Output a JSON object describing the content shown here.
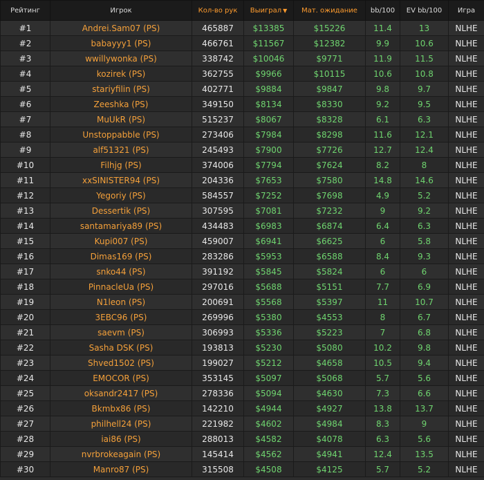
{
  "headers": {
    "rank": "Рейтинг",
    "player": "Игрок",
    "hands": "Кол-во рук",
    "won": "Выиграл",
    "ev": "Мат. ожидание",
    "bb100": "bb/100",
    "evbb100": "EV bb/100",
    "game": "Игра"
  },
  "sort": {
    "column": "won",
    "direction": "desc",
    "indicator": "▼"
  },
  "colors": {
    "accent": "#ff9c2e",
    "positive": "#6fd46f",
    "player": "#f4a03a",
    "text": "#e8e8e8",
    "background": "#2d2d2d"
  },
  "rows": [
    {
      "rank": "#1",
      "player": "Andrei.Sam07 (PS)",
      "hands": "465887",
      "won": "$13385",
      "ev": "$15226",
      "bb100": "11.4",
      "evbb100": "13",
      "game": "NLHE"
    },
    {
      "rank": "#2",
      "player": "babayyy1 (PS)",
      "hands": "466761",
      "won": "$11567",
      "ev": "$12382",
      "bb100": "9.9",
      "evbb100": "10.6",
      "game": "NLHE"
    },
    {
      "rank": "#3",
      "player": "wwillywonka (PS)",
      "hands": "338742",
      "won": "$10046",
      "ev": "$9771",
      "bb100": "11.9",
      "evbb100": "11.5",
      "game": "NLHE"
    },
    {
      "rank": "#4",
      "player": "kozirek (PS)",
      "hands": "362755",
      "won": "$9966",
      "ev": "$10115",
      "bb100": "10.6",
      "evbb100": "10.8",
      "game": "NLHE"
    },
    {
      "rank": "#5",
      "player": "stariyfilin (PS)",
      "hands": "402771",
      "won": "$9884",
      "ev": "$9847",
      "bb100": "9.8",
      "evbb100": "9.7",
      "game": "NLHE"
    },
    {
      "rank": "#6",
      "player": "Zeeshka (PS)",
      "hands": "349150",
      "won": "$8134",
      "ev": "$8330",
      "bb100": "9.2",
      "evbb100": "9.5",
      "game": "NLHE"
    },
    {
      "rank": "#7",
      "player": "MuUkR (PS)",
      "hands": "515237",
      "won": "$8067",
      "ev": "$8328",
      "bb100": "6.1",
      "evbb100": "6.3",
      "game": "NLHE"
    },
    {
      "rank": "#8",
      "player": "Unstoppabble (PS)",
      "hands": "273406",
      "won": "$7984",
      "ev": "$8298",
      "bb100": "11.6",
      "evbb100": "12.1",
      "game": "NLHE"
    },
    {
      "rank": "#9",
      "player": "alf51321 (PS)",
      "hands": "245493",
      "won": "$7900",
      "ev": "$7726",
      "bb100": "12.7",
      "evbb100": "12.4",
      "game": "NLHE"
    },
    {
      "rank": "#10",
      "player": "Filhjg (PS)",
      "hands": "374006",
      "won": "$7794",
      "ev": "$7624",
      "bb100": "8.2",
      "evbb100": "8",
      "game": "NLHE"
    },
    {
      "rank": "#11",
      "player": "xxSINISTER94 (PS)",
      "hands": "204336",
      "won": "$7653",
      "ev": "$7580",
      "bb100": "14.8",
      "evbb100": "14.6",
      "game": "NLHE"
    },
    {
      "rank": "#12",
      "player": "Yegoriy (PS)",
      "hands": "584557",
      "won": "$7252",
      "ev": "$7698",
      "bb100": "4.9",
      "evbb100": "5.2",
      "game": "NLHE"
    },
    {
      "rank": "#13",
      "player": "Dessertik (PS)",
      "hands": "307595",
      "won": "$7081",
      "ev": "$7232",
      "bb100": "9",
      "evbb100": "9.2",
      "game": "NLHE"
    },
    {
      "rank": "#14",
      "player": "santamariya89 (PS)",
      "hands": "434483",
      "won": "$6983",
      "ev": "$6874",
      "bb100": "6.4",
      "evbb100": "6.3",
      "game": "NLHE"
    },
    {
      "rank": "#15",
      "player": "Kupi007 (PS)",
      "hands": "459007",
      "won": "$6941",
      "ev": "$6625",
      "bb100": "6",
      "evbb100": "5.8",
      "game": "NLHE"
    },
    {
      "rank": "#16",
      "player": "Dimas169 (PS)",
      "hands": "283286",
      "won": "$5953",
      "ev": "$6588",
      "bb100": "8.4",
      "evbb100": "9.3",
      "game": "NLHE"
    },
    {
      "rank": "#17",
      "player": "snko44 (PS)",
      "hands": "391192",
      "won": "$5845",
      "ev": "$5824",
      "bb100": "6",
      "evbb100": "6",
      "game": "NLHE"
    },
    {
      "rank": "#18",
      "player": "PinnacleUa (PS)",
      "hands": "297016",
      "won": "$5688",
      "ev": "$5151",
      "bb100": "7.7",
      "evbb100": "6.9",
      "game": "NLHE"
    },
    {
      "rank": "#19",
      "player": "N1leon (PS)",
      "hands": "200691",
      "won": "$5568",
      "ev": "$5397",
      "bb100": "11",
      "evbb100": "10.7",
      "game": "NLHE"
    },
    {
      "rank": "#20",
      "player": "3EBC96 (PS)",
      "hands": "269996",
      "won": "$5380",
      "ev": "$4553",
      "bb100": "8",
      "evbb100": "6.7",
      "game": "NLHE"
    },
    {
      "rank": "#21",
      "player": "saevm (PS)",
      "hands": "306993",
      "won": "$5336",
      "ev": "$5223",
      "bb100": "7",
      "evbb100": "6.8",
      "game": "NLHE"
    },
    {
      "rank": "#22",
      "player": "Sasha DSK (PS)",
      "hands": "193813",
      "won": "$5230",
      "ev": "$5080",
      "bb100": "10.2",
      "evbb100": "9.8",
      "game": "NLHE"
    },
    {
      "rank": "#23",
      "player": "Shved1502 (PS)",
      "hands": "199027",
      "won": "$5212",
      "ev": "$4658",
      "bb100": "10.5",
      "evbb100": "9.4",
      "game": "NLHE"
    },
    {
      "rank": "#24",
      "player": "EMOCOR (PS)",
      "hands": "353145",
      "won": "$5097",
      "ev": "$5068",
      "bb100": "5.7",
      "evbb100": "5.6",
      "game": "NLHE"
    },
    {
      "rank": "#25",
      "player": "oksandr2417 (PS)",
      "hands": "278336",
      "won": "$5094",
      "ev": "$4630",
      "bb100": "7.3",
      "evbb100": "6.6",
      "game": "NLHE"
    },
    {
      "rank": "#26",
      "player": "Bkmbx86 (PS)",
      "hands": "142210",
      "won": "$4944",
      "ev": "$4927",
      "bb100": "13.8",
      "evbb100": "13.7",
      "game": "NLHE"
    },
    {
      "rank": "#27",
      "player": "philhell24 (PS)",
      "hands": "221982",
      "won": "$4602",
      "ev": "$4984",
      "bb100": "8.3",
      "evbb100": "9",
      "game": "NLHE"
    },
    {
      "rank": "#28",
      "player": "iai86 (PS)",
      "hands": "288013",
      "won": "$4582",
      "ev": "$4078",
      "bb100": "6.3",
      "evbb100": "5.6",
      "game": "NLHE"
    },
    {
      "rank": "#29",
      "player": "nvrbrokeagain (PS)",
      "hands": "145414",
      "won": "$4562",
      "ev": "$4941",
      "bb100": "12.4",
      "evbb100": "13.5",
      "game": "NLHE"
    },
    {
      "rank": "#30",
      "player": "Manro87 (PS)",
      "hands": "315508",
      "won": "$4508",
      "ev": "$4125",
      "bb100": "5.7",
      "evbb100": "5.2",
      "game": "NLHE"
    }
  ]
}
